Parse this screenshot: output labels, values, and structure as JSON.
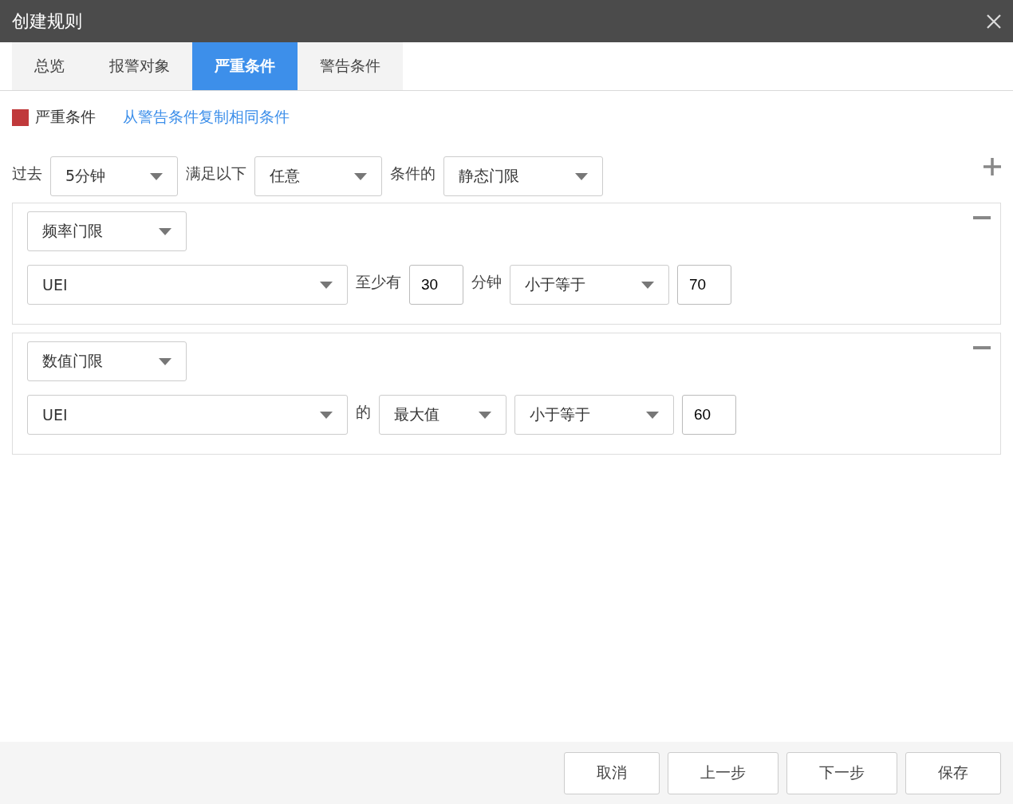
{
  "window": {
    "title": "创建规则"
  },
  "tabs": [
    {
      "label": "总览",
      "selected": false
    },
    {
      "label": "报警对象",
      "selected": false
    },
    {
      "label": "严重条件",
      "selected": true
    },
    {
      "label": "警告条件",
      "selected": false
    }
  ],
  "section": {
    "label": "严重条件",
    "copy_link": "从警告条件复制相同条件"
  },
  "criteria": [
    {
      "kind": "label",
      "text": "过去"
    },
    {
      "kind": "select",
      "text": "5分钟"
    },
    {
      "kind": "label",
      "text": "满足以下"
    },
    {
      "kind": "select",
      "text": "任意"
    },
    {
      "kind": "label",
      "text": "条件的"
    },
    {
      "kind": "dropdown",
      "text": "静态门限"
    }
  ],
  "conditions": [
    {
      "type": "频率门限",
      "fields": [
        {
          "kind": "metric",
          "text": "UEI"
        },
        {
          "kind": "label",
          "text": "至少有"
        },
        {
          "kind": "input",
          "text": "30"
        },
        {
          "kind": "label",
          "text": "分钟"
        },
        {
          "kind": "dropdown",
          "text": "小于等于"
        },
        {
          "kind": "input",
          "text": "70"
        }
      ]
    },
    {
      "type": "数值门限",
      "fields": [
        {
          "kind": "metric",
          "text": "UEI"
        },
        {
          "kind": "label",
          "text": "的"
        },
        {
          "kind": "select",
          "text": "最大值"
        },
        {
          "kind": "dropdown",
          "text": "小于等于"
        },
        {
          "kind": "input",
          "text": "60"
        }
      ]
    }
  ],
  "buttons": [
    "取消",
    "上一步",
    "下一步",
    "保存"
  ]
}
